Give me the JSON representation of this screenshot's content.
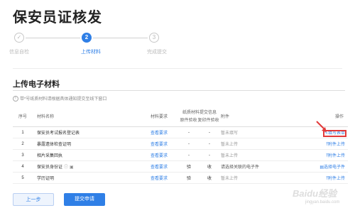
{
  "page_title": "保安员证核发",
  "steps": [
    {
      "number": "✓",
      "label": "信息自检"
    },
    {
      "number": "2",
      "label": "上传材料"
    },
    {
      "number": "3",
      "label": "完成提交"
    }
  ],
  "section_title": "上传电子材料",
  "notice_text": "带*号纸质材料请根据具体通知提交至线下窗口",
  "table": {
    "headers": {
      "index": "序号",
      "name": "材料名称",
      "requirement": "材料要求",
      "submit_group": "纸质材料提交信息",
      "original": "原件验收",
      "copy": "复印件验收",
      "attachment": "附件",
      "operation": "操作"
    },
    "rows": [
      {
        "index": "1",
        "name": "保安员考试报名登记表",
        "requirement": "查看要求",
        "original": "-",
        "copy": "-",
        "attachment": "暂未填写",
        "operation": "填写表单"
      },
      {
        "index": "2",
        "name": "暴露遗体检查证明",
        "requirement": "查看要求",
        "original": "-",
        "copy": "-",
        "attachment": "暂未上传",
        "operation": "附件上传"
      },
      {
        "index": "3",
        "name": "相片采集回执",
        "requirement": "查看要求",
        "original": "-",
        "copy": "-",
        "attachment": "暂未上传",
        "operation": "附件上传"
      },
      {
        "index": "4",
        "name": "保安员身份证",
        "requirement": "查看要求",
        "original": "验",
        "copy": "收",
        "attachment": "请选择关联的电子件",
        "operation": "选择电子件"
      },
      {
        "index": "5",
        "name": "学历证明",
        "requirement": "查看要求",
        "original": "验",
        "copy": "收",
        "attachment": "暂未上传",
        "operation": "附件上传"
      }
    ]
  },
  "buttons": {
    "prev": "上一步",
    "submit": "提交申请"
  },
  "watermark": "Baidu经验",
  "watermark_sub": "jingyan.baidu.com",
  "colors": {
    "accent": "#2f7fe6",
    "highlight": "#e23b3b"
  }
}
